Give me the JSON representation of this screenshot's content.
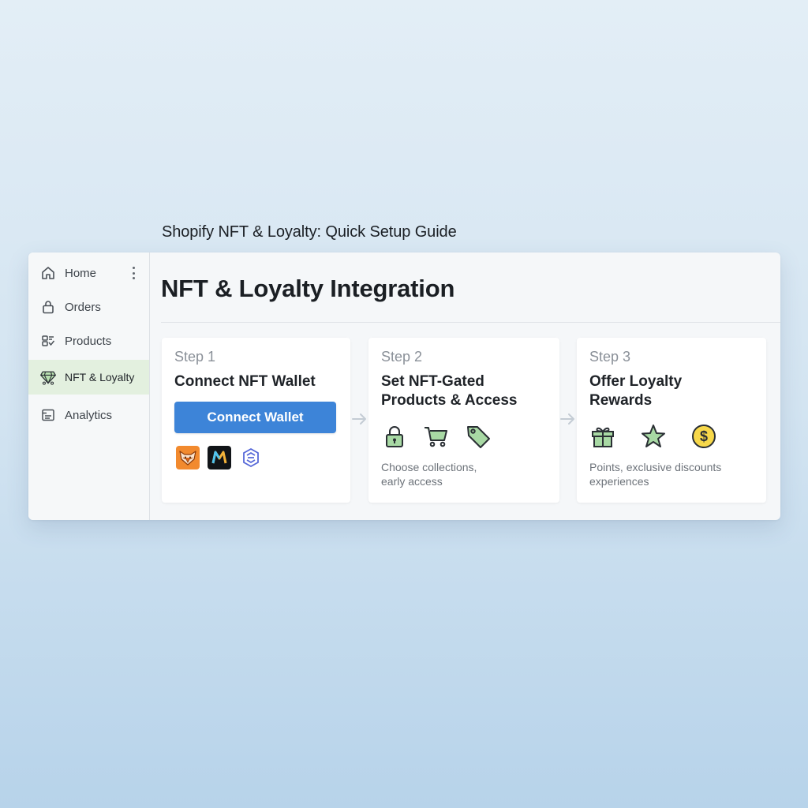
{
  "caption": "Shopify NFT & Loyalty: Quick Setup Guide",
  "sidebar": {
    "items": [
      {
        "label": "Home",
        "icon": "home-icon"
      },
      {
        "label": "Orders",
        "icon": "lock-icon"
      },
      {
        "label": "Products",
        "icon": "products-icon"
      },
      {
        "label": "NFT & Loyalty",
        "icon": "diamond-icon",
        "active": true
      },
      {
        "label": "Analytics",
        "icon": "analytics-icon"
      }
    ]
  },
  "main": {
    "title": "NFT & Loyalty Integration",
    "steps": [
      {
        "step_label": "Step 1",
        "title": "Connect NFT Wallet",
        "button_label": "Connect Wallet",
        "wallets": [
          "fox-wallet-icon",
          "m-wallet-icon",
          "link-wallet-icon"
        ]
      },
      {
        "step_label": "Step 2",
        "title": "Set NFT-Gated Products & Access",
        "icons": [
          "padlock-icon",
          "cart-icon",
          "tag-icon"
        ],
        "description": "Choose collections, early access"
      },
      {
        "step_label": "Step 3",
        "title": "Offer Loyalty Rewards",
        "icons": [
          "gift-icon",
          "star-icon",
          "coin-icon"
        ],
        "description": "Points, exclusive discounts experiences"
      }
    ]
  },
  "colors": {
    "accent_button": "#3d84d8",
    "active_nav_bg": "#e3f0df",
    "icon_green": "#a8d9a4",
    "coin_yellow": "#f7d84a",
    "fox_orange": "#f28a2e"
  }
}
